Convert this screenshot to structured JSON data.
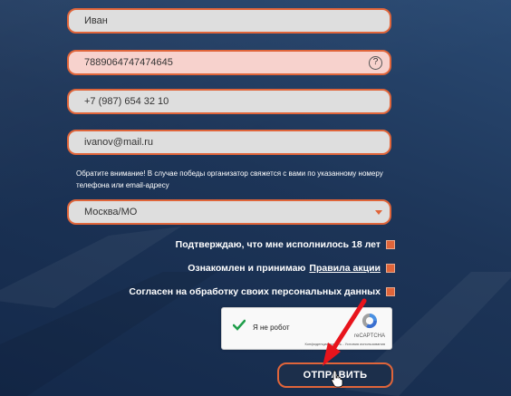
{
  "form": {
    "name_value": "Иван",
    "phone_error_value": "7889064747474645",
    "help_icon_glyph": "?",
    "phone_value": "+7 (987) 654 32 10",
    "email_value": "ivanov@mail.ru",
    "notice_text": "Обратите внимание! В случае победы организатор свяжется с вами по указанному номеру телефона или email-адресу",
    "region_selected": "Москва/МО",
    "check_age_label": "Подтверждаю, что мне исполнилось 18 лет",
    "check_rules_prefix": "Ознакомлен и принимаю",
    "check_rules_link": "Правила акции",
    "check_personal_label": "Согласен на обработку своих персональных данных",
    "submit_label": "ОТПРАВИТЬ"
  },
  "recaptcha": {
    "label": "Я не робот",
    "brand": "reCAPTCHA",
    "terms": "Конфиденциальность - Условия использования"
  },
  "colors": {
    "accent": "#e0653a",
    "error_bg": "#f7d2cd",
    "field_bg": "#dedede",
    "page_bg": "#1d3558",
    "annotation_arrow": "#e8141c"
  },
  "icons": [
    "help-icon",
    "chevron-down-icon",
    "checkmark-icon",
    "recaptcha-logo-icon",
    "annotation-arrow-icon",
    "hand-cursor-icon"
  ]
}
